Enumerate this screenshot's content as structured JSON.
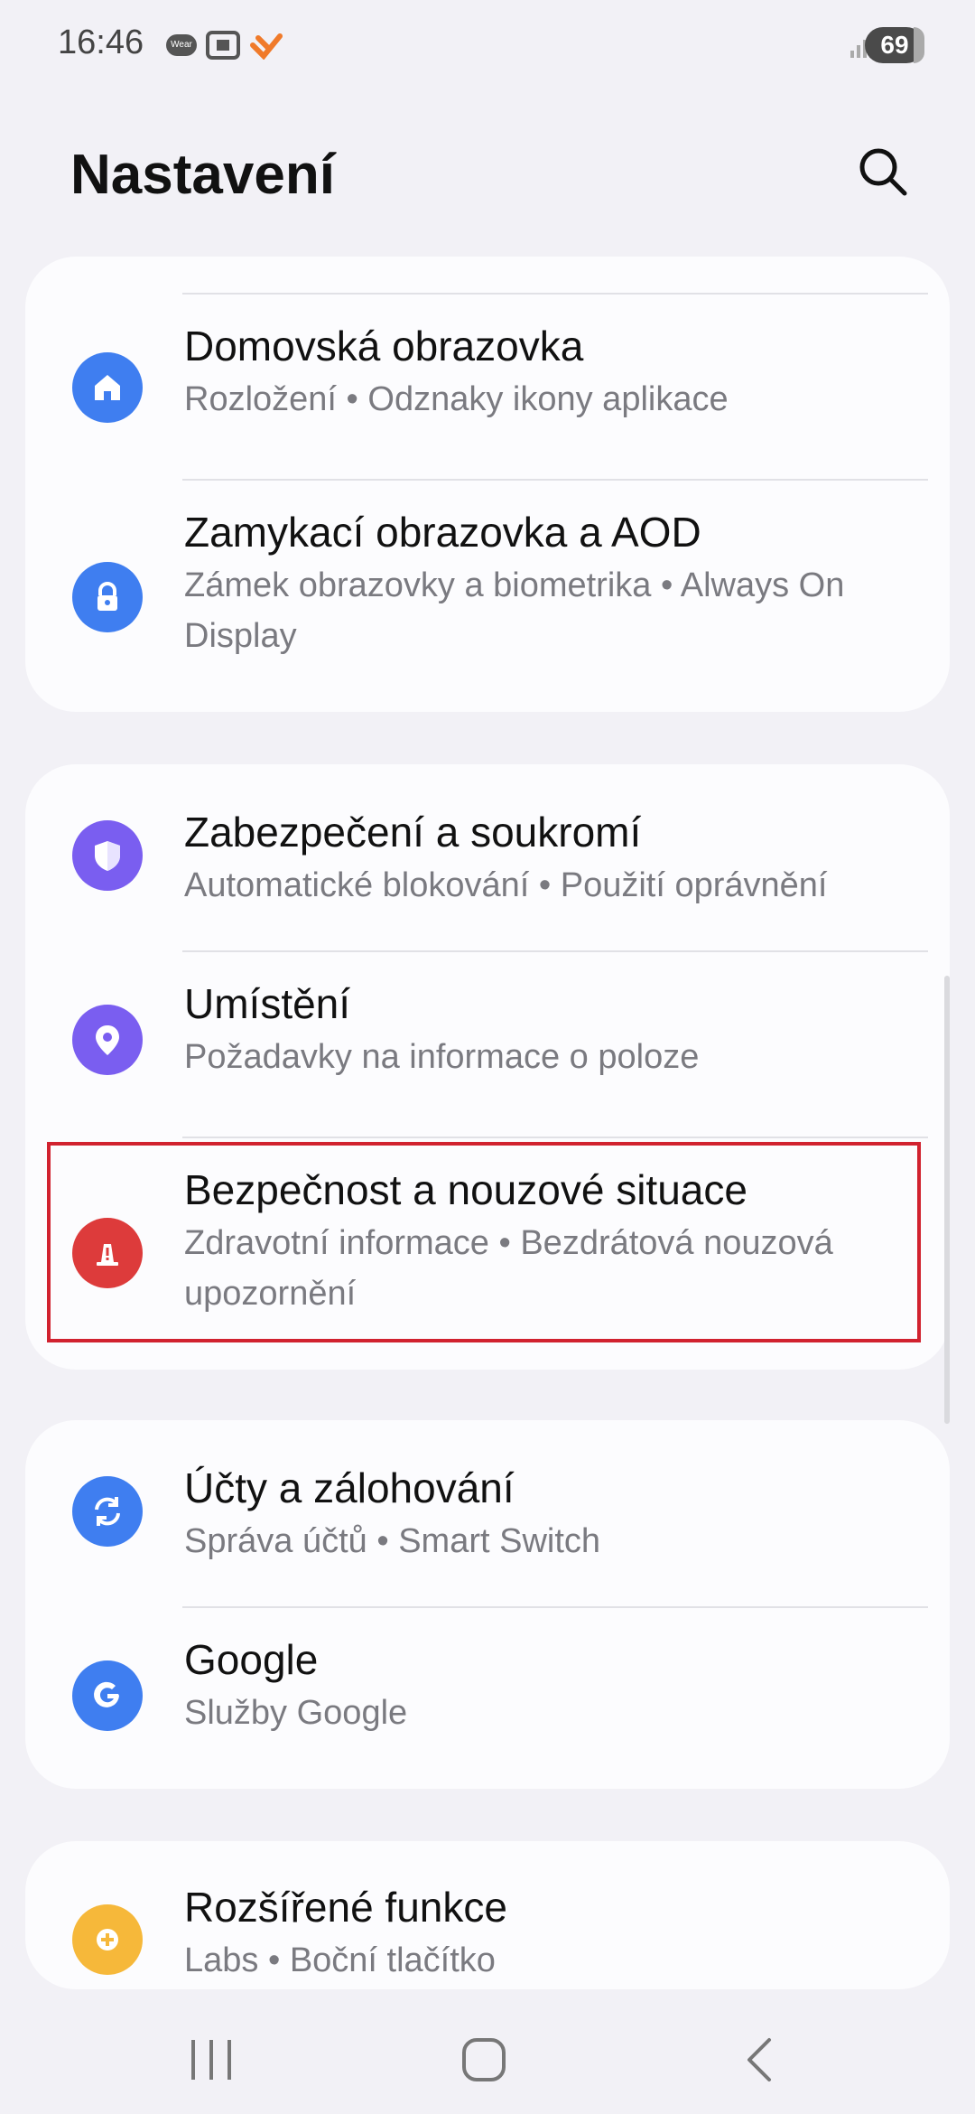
{
  "status_bar": {
    "time": "16:46",
    "wear_label": "Wear",
    "battery": "69"
  },
  "header": {
    "title": "Nastavení",
    "search_icon": "search-icon"
  },
  "cards": [
    {
      "items": [
        {
          "title": "Domovská obrazovka",
          "subtitle": "Rozložení • Odznaky ikony aplikace",
          "icon": "home-icon",
          "color": "#3f7ef0"
        },
        {
          "title": "Zamykací obrazovka a AOD",
          "subtitle": "Zámek obrazovky a biometrika • Always On Display",
          "icon": "lock-icon",
          "color": "#3f7ef0"
        }
      ]
    },
    {
      "items": [
        {
          "title": "Zabezpečení a soukromí",
          "subtitle": "Automatické blokování • Použití oprávnění",
          "icon": "shield-icon",
          "color": "#7a5ef0"
        },
        {
          "title": "Umístění",
          "subtitle": "Požadavky na informace o poloze",
          "icon": "location-icon",
          "color": "#7a5ef0"
        },
        {
          "title": "Bezpečnost a nouzové situace",
          "subtitle": "Zdravotní informace • Bezdrátová nouzová upozornění",
          "icon": "emergency-icon",
          "color": "#dd3b3b"
        }
      ]
    },
    {
      "items": [
        {
          "title": "Účty a zálohování",
          "subtitle": "Správa účtů • Smart Switch",
          "icon": "sync-icon",
          "color": "#3f7ef0"
        },
        {
          "title": "Google",
          "subtitle": "Služby Google",
          "icon": "google-icon",
          "color": "#3f7ef0"
        }
      ]
    },
    {
      "items": [
        {
          "title": "Rozšířené funkce",
          "subtitle": "Labs • Boční tlačítko",
          "icon": "plus-gear-icon",
          "color": "#f6b83a"
        }
      ]
    }
  ],
  "highlight_color": "#d1222f",
  "navbar": {
    "recents_icon": "recents-icon",
    "home_icon": "home-button-icon",
    "back_icon": "back-icon"
  }
}
